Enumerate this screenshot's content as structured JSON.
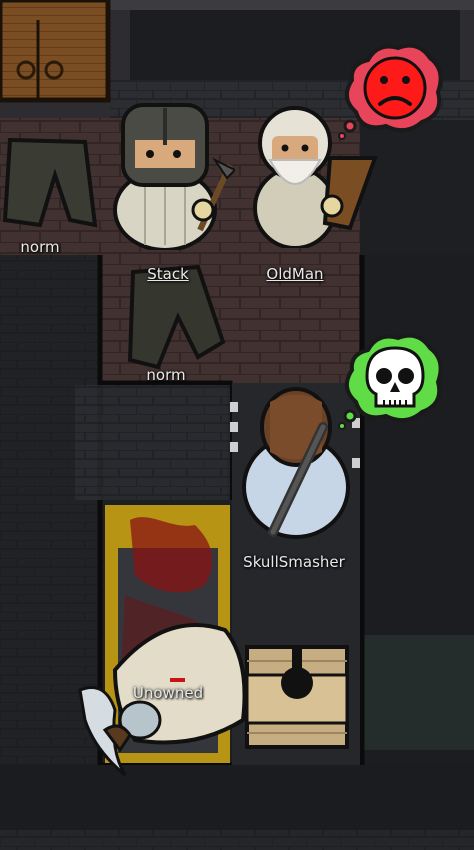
{
  "pawns": [
    {
      "id": "stack",
      "name": "Stack",
      "selectable": true
    },
    {
      "id": "oldman",
      "name": "OldMan",
      "selectable": true
    },
    {
      "id": "skullsmasher",
      "name": "SkullSmasher",
      "selectable": false
    }
  ],
  "items": [
    {
      "id": "pants1",
      "label": "norm"
    },
    {
      "id": "pants2",
      "label": "norm"
    },
    {
      "id": "corpse",
      "label": "Unowned"
    }
  ],
  "mood_bubbles": [
    {
      "id": "sad",
      "icon": "sad-face-icon",
      "color": "#ff1a1a",
      "cloud": "#e8445a"
    },
    {
      "id": "skull",
      "icon": "skull-icon",
      "color": "#ffffff",
      "cloud": "#5fdc46"
    }
  ],
  "colors": {
    "brick_floor": "#4a3836",
    "dark_floor": "#222426",
    "wall": "#2a2a2e",
    "blood": "#8a1414"
  }
}
